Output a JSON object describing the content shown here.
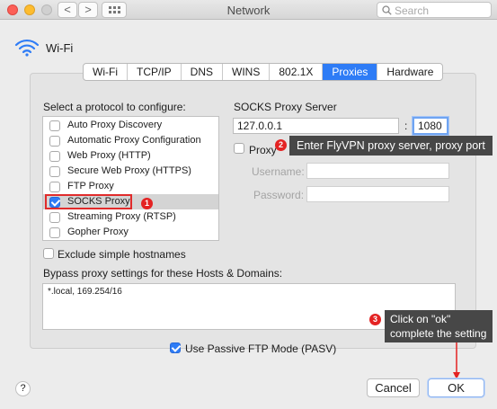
{
  "window": {
    "title": "Network",
    "search_placeholder": "Search"
  },
  "toolbar": {
    "back_glyph": "<",
    "forward_glyph": ">"
  },
  "header": {
    "interface_name": "Wi-Fi"
  },
  "tabs": [
    {
      "label": "Wi-Fi"
    },
    {
      "label": "TCP/IP"
    },
    {
      "label": "DNS"
    },
    {
      "label": "WINS"
    },
    {
      "label": "802.1X"
    },
    {
      "label": "Proxies",
      "active": true
    },
    {
      "label": "Hardware"
    }
  ],
  "protocols": {
    "heading": "Select a protocol to configure:",
    "items": [
      {
        "label": "Auto Proxy Discovery",
        "checked": false
      },
      {
        "label": "Automatic Proxy Configuration",
        "checked": false
      },
      {
        "label": "Web Proxy (HTTP)",
        "checked": false
      },
      {
        "label": "Secure Web Proxy (HTTPS)",
        "checked": false
      },
      {
        "label": "FTP Proxy",
        "checked": false
      },
      {
        "label": "SOCKS Proxy",
        "checked": true,
        "selected": true
      },
      {
        "label": "Streaming Proxy (RTSP)",
        "checked": false
      },
      {
        "label": "Gopher Proxy",
        "checked": false
      }
    ]
  },
  "socks": {
    "heading": "SOCKS Proxy Server",
    "server": "127.0.0.1",
    "separator": ":",
    "port": "1080",
    "password_required_label": "Proxy",
    "username_label": "Username:",
    "password_label": "Password:"
  },
  "annotations": {
    "badge1": "1",
    "badge2": "2",
    "badge3": "3",
    "tip2": "Enter FlyVPN proxy server, proxy port",
    "tip3_line1": "Click on \"ok\"",
    "tip3_line2": "complete the setting",
    "colors": {
      "badge": "#e42323",
      "highlight": "#e02b2b",
      "tooltip_bg": "#474747"
    }
  },
  "exclude_simple": {
    "label": "Exclude simple hostnames",
    "checked": false
  },
  "bypass": {
    "label": "Bypass proxy settings for these Hosts & Domains:",
    "value": "*.local, 169.254/16"
  },
  "passive_ftp": {
    "label": "Use Passive FTP Mode (PASV)",
    "checked": true
  },
  "buttons": {
    "help": "?",
    "cancel": "Cancel",
    "ok": "OK"
  },
  "accent_color": "#2e7cf6"
}
